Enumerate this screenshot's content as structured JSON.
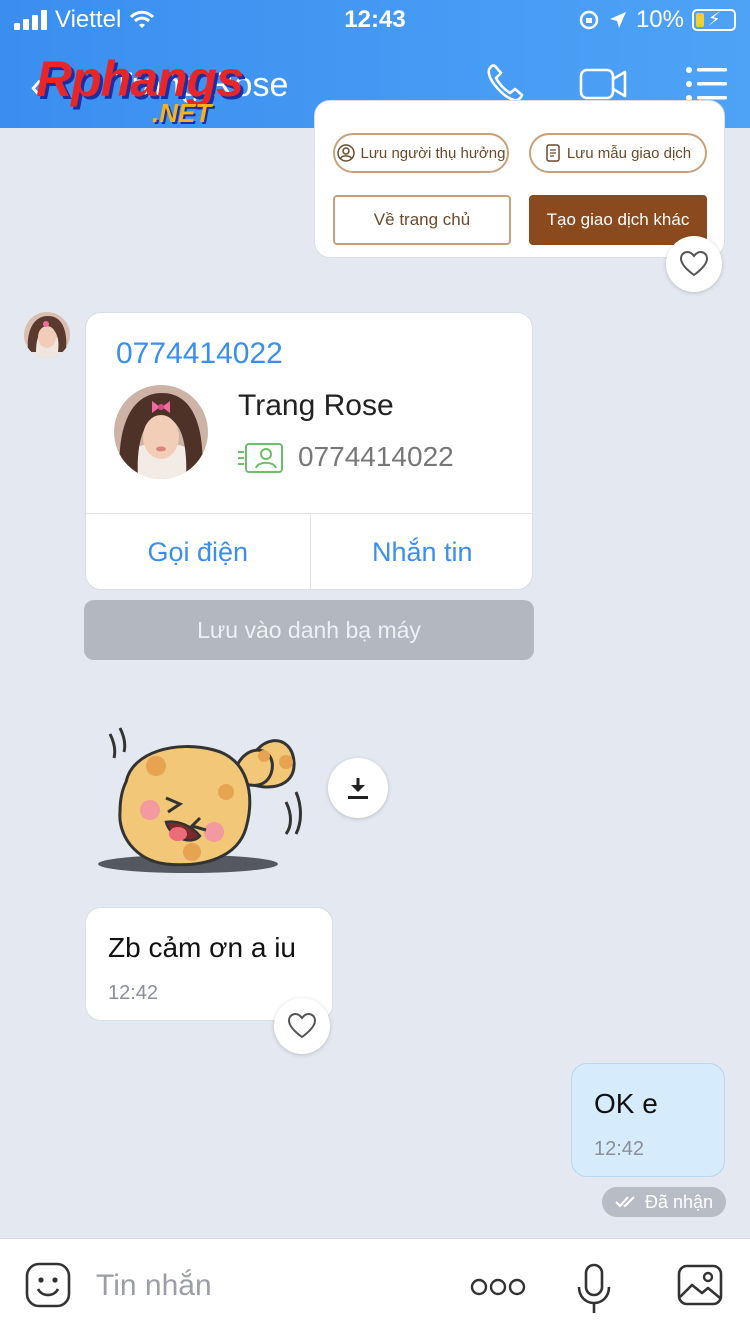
{
  "status_bar": {
    "carrier": "Viettel",
    "time": "12:43",
    "battery": "10%",
    "icons": [
      "signal-icon",
      "wifi-icon",
      "rotation-lock-icon",
      "location-icon",
      "battery-charging-icon"
    ]
  },
  "header": {
    "back_icon": "chevron-left-icon",
    "title": "Trang Rose",
    "logo_main": "Rphangs",
    "logo_sub": ".NET",
    "actions": [
      "phone-icon",
      "video-camera-icon",
      "menu-icon"
    ]
  },
  "transaction_card": {
    "save_beneficiary": "Lưu người thụ hưởng",
    "save_template": "Lưu mẫu giao dịch",
    "home_button": "Về trang chủ",
    "new_transaction_button": "Tạo giao dịch khác"
  },
  "contact_card": {
    "phone": "0774414022",
    "name": "Trang Rose",
    "number": "0774414022",
    "call_button": "Gọi điện",
    "message_button": "Nhắn tin",
    "save_contact_button": "Lưu vào danh bạ máy"
  },
  "messages": [
    {
      "text": "Zb cảm ơn a iu",
      "time": "12:42"
    },
    {
      "text": "OK e",
      "time": "12:42",
      "status": "Đã nhận"
    }
  ],
  "composer": {
    "placeholder": "Tin nhắn",
    "icons": [
      "emoji-icon",
      "more-icon",
      "microphone-icon",
      "image-icon"
    ]
  },
  "colors": {
    "header_blue": "#3a8ef0",
    "accent_brown": "#8b4a1d",
    "chat_bg": "#e4e8f0",
    "sent_bubble": "#d6ebfb"
  }
}
